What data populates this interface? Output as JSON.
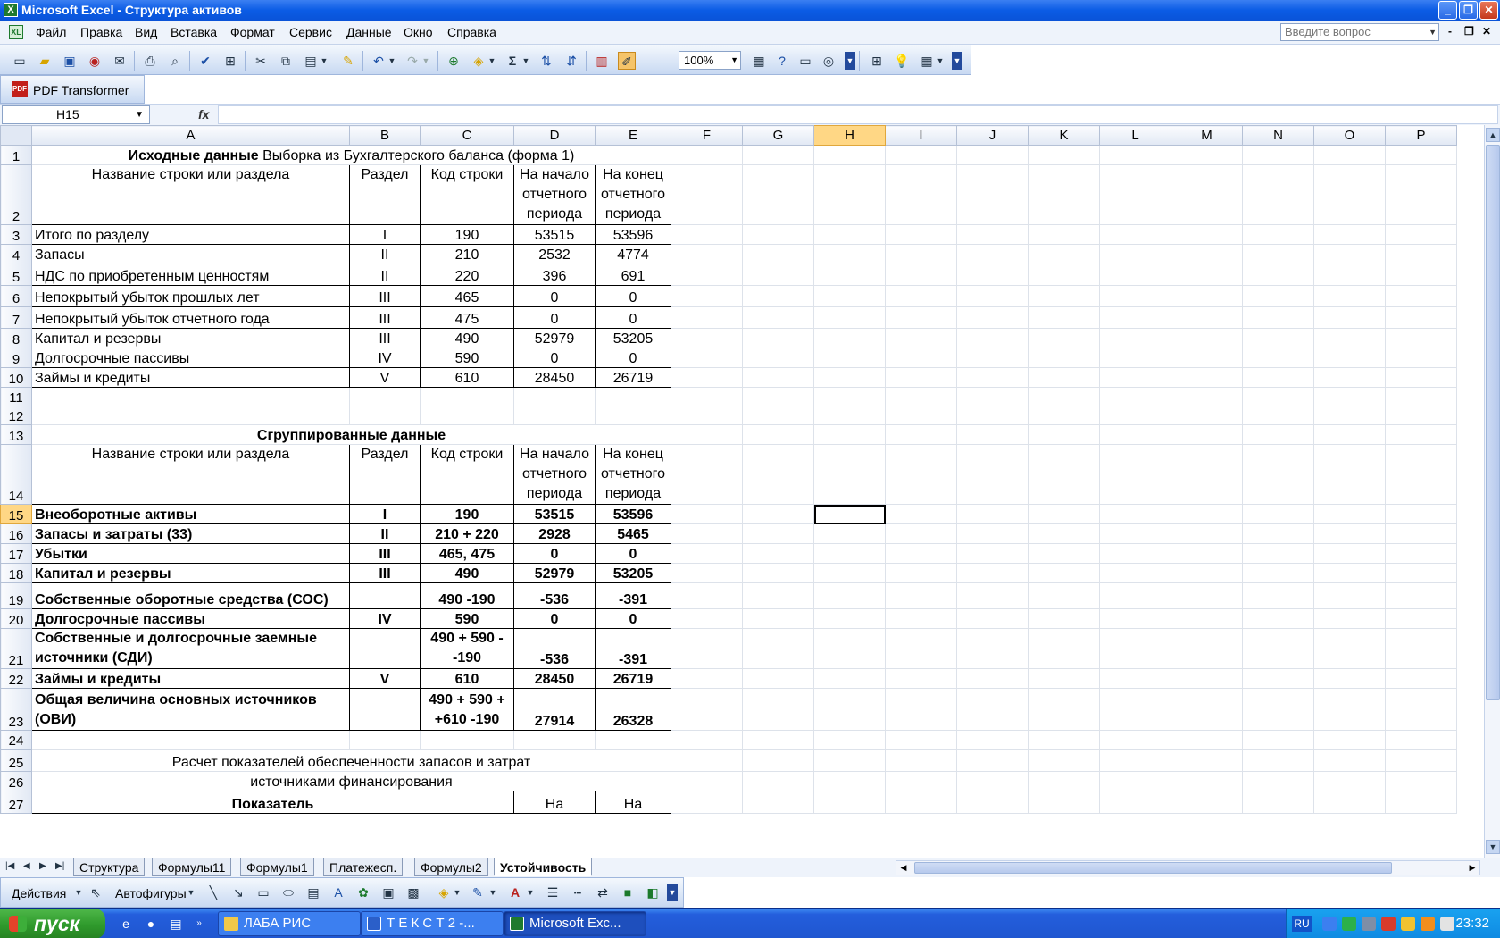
{
  "window": {
    "title": "Microsoft Excel - Структура активов",
    "buttons": [
      "_",
      "❐",
      "✕"
    ]
  },
  "menu": {
    "items": [
      "Файл",
      "Правка",
      "Вид",
      "Вставка",
      "Формат",
      "Сервис",
      "Данные",
      "Окно",
      "Справка"
    ],
    "help_placeholder": "Введите вопрос"
  },
  "toolbar": {
    "zoom": "100%"
  },
  "pdf_toolbar": {
    "label": "PDF Transformer"
  },
  "formula_bar": {
    "name_box": "H15",
    "fx": "fx",
    "formula": ""
  },
  "columns": [
    "A",
    "B",
    "C",
    "D",
    "E",
    "F",
    "G",
    "H",
    "I",
    "J",
    "K",
    "L",
    "M",
    "N",
    "O",
    "P"
  ],
  "selected_column": "H",
  "selected_row": "15",
  "rows": [
    {
      "n": "1",
      "h": 22,
      "title_bold": "Исходные данные",
      "title_rest": " Выборка из Бухгалтерского баланса (форма 1)"
    },
    {
      "n": "2",
      "h": 67,
      "header": true,
      "a": "Название строки или раздела",
      "b": "Раздел",
      "c": "Код строки",
      "d": "На начало отчетного периода",
      "e": "На конец отчетного периода"
    },
    {
      "n": "3",
      "h": 22,
      "a": "Итого по разделу",
      "b": "I",
      "c": "190",
      "d": "53515",
      "e": "53596"
    },
    {
      "n": "4",
      "h": 22,
      "a": "Запасы",
      "b": "II",
      "c": "210",
      "d": "2532",
      "e": "4774"
    },
    {
      "n": "5",
      "h": 24,
      "a": "НДС по приобретенным ценностям",
      "b": "II",
      "c": "220",
      "d": "396",
      "e": "691"
    },
    {
      "n": "6",
      "h": 24,
      "a": "Непокрытый убыток прошлых лет",
      "b": "III",
      "c": "465",
      "d": "0",
      "e": "0"
    },
    {
      "n": "7",
      "h": 24,
      "a": "Непокрытый убыток отчетного года",
      "b": "III",
      "c": "475",
      "d": "0",
      "e": "0"
    },
    {
      "n": "8",
      "h": 22,
      "a": "Капитал и резервы",
      "b": "III",
      "c": "490",
      "d": "52979",
      "e": "53205"
    },
    {
      "n": "9",
      "h": 22,
      "a": "Долгосрочные пассивы",
      "b": "IV",
      "c": "590",
      "d": "0",
      "e": "0"
    },
    {
      "n": "10",
      "h": 22,
      "a": "Займы и кредиты",
      "b": "V",
      "c": "610",
      "d": "28450",
      "e": "26719"
    },
    {
      "n": "11",
      "h": 21,
      "empty": true
    },
    {
      "n": "12",
      "h": 21,
      "empty": true
    },
    {
      "n": "13",
      "h": 22,
      "title_center": "Сгруппированные данные"
    },
    {
      "n": "14",
      "h": 67,
      "header": true,
      "a": "Название строки или раздела",
      "b": "Раздел",
      "c": "Код строки",
      "d": "На начало отчетного периода",
      "e": "На конец отчетного периода"
    },
    {
      "n": "15",
      "h": 22,
      "bold": true,
      "a": "Внеоборотные активы",
      "b": "I",
      "c": "190",
      "d": "53515",
      "e": "53596"
    },
    {
      "n": "16",
      "h": 22,
      "bold": true,
      "a": "Запасы и затраты (33)",
      "b": "II",
      "c": "210 + 220",
      "d": "2928",
      "e": "5465"
    },
    {
      "n": "17",
      "h": 22,
      "bold": true,
      "a": "Убытки",
      "b": "III",
      "c": "465, 475",
      "d": "0",
      "e": "0"
    },
    {
      "n": "18",
      "h": 22,
      "bold": true,
      "a": "Капитал и резервы",
      "b": "III",
      "c": "490",
      "d": "52979",
      "e": "53205"
    },
    {
      "n": "19",
      "h": 29,
      "bold": true,
      "a": "Собственные оборотные средства (СОС)",
      "b": "",
      "c": "490 -190",
      "d": "-536",
      "e": "-391"
    },
    {
      "n": "20",
      "h": 22,
      "bold": true,
      "a": "Долгосрочные пассивы",
      "b": "IV",
      "c": "590",
      "d": "0",
      "e": "0"
    },
    {
      "n": "21",
      "h": 45,
      "bold": true,
      "multi": true,
      "a": "Собственные и долгосрочные заемные источники (СДИ)",
      "b": "",
      "c": "490 + 590 - -190",
      "d": "-536",
      "e": "-391"
    },
    {
      "n": "22",
      "h": 22,
      "bold": true,
      "a": "Займы и кредиты",
      "b": "V",
      "c": "610",
      "d": "28450",
      "e": "26719"
    },
    {
      "n": "23",
      "h": 47,
      "bold": true,
      "multi": true,
      "a": "Общая величина основных источников (ОВИ)",
      "b": "",
      "c": "490 + 590 + +610 -190",
      "d": "27914",
      "e": "26328"
    },
    {
      "n": "24",
      "h": 21,
      "empty": true
    },
    {
      "n": "25",
      "h": 25,
      "title_plain": "Расчет показателей обеспеченности запасов и затрат"
    },
    {
      "n": "26",
      "h": 22,
      "title_plain": "источниками финансирования"
    },
    {
      "n": "27",
      "h": 25,
      "partial": true,
      "a": "Показатель",
      "d": "На",
      "e": "На"
    }
  ],
  "sheet_tabs": [
    "Структура",
    "Формулы11",
    "Формулы1",
    "Платежесп.",
    "Формулы2",
    "Устойчивость"
  ],
  "active_tab": "Устойчивость",
  "drawing_toolbar": {
    "actions": "Действия",
    "autoshapes": "Автофигуры"
  },
  "taskbar": {
    "start": "пуск",
    "tasks": [
      "ЛАБА РИС",
      "Т Е К С Т 2 -...",
      "Microsoft Exc..."
    ],
    "lang": "RU",
    "clock": "23:32"
  }
}
